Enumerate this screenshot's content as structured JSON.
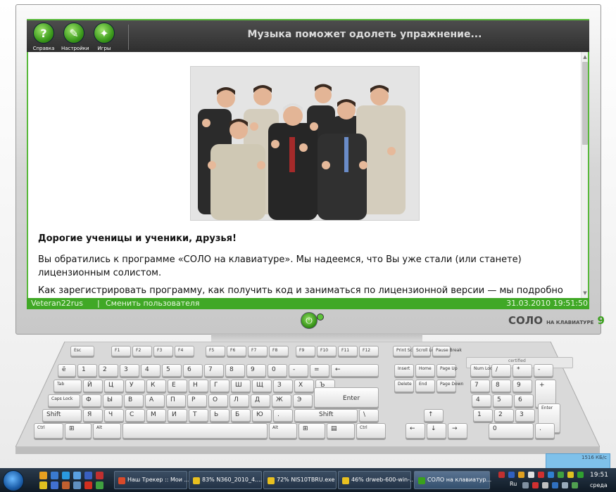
{
  "toolbar": {
    "buttons": [
      {
        "label": "Справка",
        "icon": "help-icon",
        "glyph": "?"
      },
      {
        "label": "Настройки",
        "icon": "settings-icon",
        "glyph": "✎"
      },
      {
        "label": "Игры",
        "icon": "games-icon",
        "glyph": "✦"
      }
    ],
    "title": "Музыка поможет одолеть упражнение..."
  },
  "content": {
    "greeting": "Дорогие ученицы и ученики, друзья!",
    "paragraph1": "Вы обратились к программе «СОЛО на клавиатуре». Мы надеемся, что Вы уже стали (или станете) лицензионным солистом.",
    "paragraph2": "Как зарегистрировать программу, как получить код и заниматься по лицензионной версии — мы подробно"
  },
  "status": {
    "user": "Veteran22rus",
    "separator": "|",
    "switch_user": "Сменить пользователя",
    "datetime": "31.03.2010 19:51:50"
  },
  "logo": {
    "main": "СОЛО",
    "sub": "НА КЛАВИАТУРЕ",
    "num": "9"
  },
  "keyboard": {
    "certified": "certified",
    "row_fn": [
      "Esc",
      "F1",
      "F2",
      "F3",
      "F4",
      "F5",
      "F6",
      "F7",
      "F8",
      "F9",
      "F10",
      "F11",
      "F12",
      "Print Scrn",
      "Scroll Lock",
      "Pause Break"
    ],
    "row_num": [
      "ё",
      "1",
      "2",
      "3",
      "4",
      "5",
      "6",
      "7",
      "8",
      "9",
      "0",
      "-",
      "=",
      "←",
      "Insert",
      "Home",
      "Page Up",
      "Num Lock",
      "/",
      "*",
      "-"
    ],
    "row_q": [
      "Tab",
      "Й",
      "Ц",
      "У",
      "К",
      "Е",
      "Н",
      "Г",
      "Ш",
      "Щ",
      "З",
      "Х",
      "Ъ",
      "Delete",
      "End",
      "Page Down",
      "7",
      "8",
      "9",
      "+"
    ],
    "row_a": [
      "Caps Lock",
      "Ф",
      "Ы",
      "В",
      "А",
      "П",
      "Р",
      "О",
      "Л",
      "Д",
      "Ж",
      "Э",
      "Enter",
      "4",
      "5",
      "6"
    ],
    "row_z": [
      "Shift",
      "Я",
      "Ч",
      "С",
      "М",
      "И",
      "Т",
      "Ь",
      "Б",
      "Ю",
      ".",
      "Shift",
      "\\",
      "↑",
      "1",
      "2",
      "3",
      "Enter"
    ],
    "row_sp": [
      "Ctrl",
      "⊞",
      "Alt",
      "Alt",
      "⊞",
      "▤",
      "Ctrl",
      "←",
      "↓",
      "→",
      "0",
      "."
    ]
  },
  "tray_popup": "1516 КБ/с",
  "taskbar": {
    "tasks": [
      {
        "label": "Наш Трекер :: Мои ...",
        "icon_color": "#d94a2a",
        "active": false
      },
      {
        "label": "83% N360_2010_4....",
        "icon_color": "#e8c020",
        "active": false
      },
      {
        "label": "72% NIS10TBRU.exe",
        "icon_color": "#e8c020",
        "active": false
      },
      {
        "label": "46% drweb-600-win-...",
        "icon_color": "#e8c020",
        "active": false
      },
      {
        "label": "СОЛО на клавиатур...",
        "icon_color": "#3aa01c",
        "active": true
      }
    ],
    "lang": "Ru",
    "time": "19:51",
    "day": "среда"
  },
  "colors": {
    "accent_green": "#40a826",
    "toolbar_dark": "#2d2d2d"
  }
}
